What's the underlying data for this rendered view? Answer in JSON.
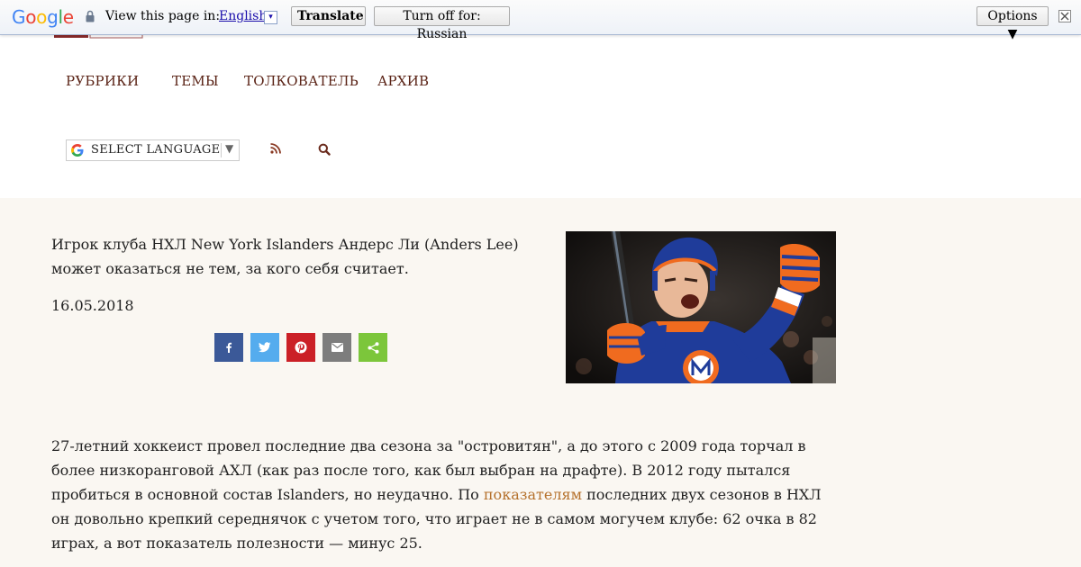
{
  "translate_bar": {
    "logo_text": "Google",
    "view_label": "View this page in:",
    "language": "English",
    "language_caret": "▾",
    "translate_button": "Translate",
    "turn_off_button": "Turn off for: Russian",
    "options_button": "Options ▼"
  },
  "nav": {
    "items": [
      "РУБРИКИ",
      "ТЕМЫ",
      "ТОЛКОВАТЕЛЬ",
      "АРХИВ"
    ]
  },
  "language_select": {
    "label": "SELECT LANGUAGE",
    "arrow": "▼"
  },
  "article": {
    "lead": "Игрок клуба НХЛ New York Islanders Андерс Ли (Anders Lee) может оказаться не тем, за кого себя считает.",
    "date": "16.05.2018",
    "share_buttons": [
      {
        "name": "facebook",
        "icon": "facebook-icon",
        "color": "#3b5998"
      },
      {
        "name": "twitter",
        "icon": "twitter-icon",
        "color": "#55acee"
      },
      {
        "name": "pinterest",
        "icon": "pinterest-icon",
        "color": "#cb2027"
      },
      {
        "name": "email",
        "icon": "email-icon",
        "color": "#7d7d7d"
      },
      {
        "name": "share",
        "icon": "share-icon",
        "color": "#7cc63b"
      }
    ],
    "body_part1": "27-летний хоккеист провел последние два сезона за \"островитян\", а до этого с 2009 года торчал в более низкоранговой АХЛ (как раз после того, как был выбран на драфте). В 2012 году пытался пробиться в основной состав Islanders, но неудачно. По ",
    "body_link": "показателям",
    "body_part2": " последних двух сезонов в НХЛ он довольно крепкий середнячок с учетом того, что играет не в самом могучем клубе: 62 очка в 82 играх, а вот показатель полезности — минус 25."
  },
  "colors": {
    "nav_text": "#5a2316",
    "article_bg": "#faf7f2",
    "link": "#b5712c"
  }
}
